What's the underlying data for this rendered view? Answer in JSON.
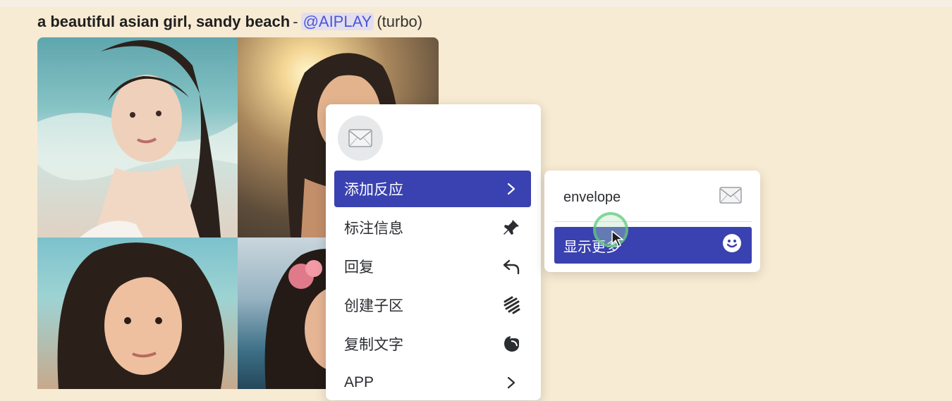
{
  "message": {
    "prompt": "a beautiful asian girl, sandy beach",
    "separator": "-",
    "mention": "@AIPLAY",
    "mode_tag": "(turbo)"
  },
  "image_grid": {
    "tiles": [
      "portrait-1",
      "portrait-2",
      "portrait-3",
      "portrait-4"
    ]
  },
  "context_menu": {
    "reaction_icon": "envelope-icon",
    "items": [
      {
        "label": "添加反应",
        "icon": "chevron-right-icon",
        "active": true
      },
      {
        "label": "标注信息",
        "icon": "pin-icon",
        "active": false
      },
      {
        "label": "回复",
        "icon": "reply-arrow-icon",
        "active": false
      },
      {
        "label": "创建子区",
        "icon": "thread-icon",
        "active": false
      },
      {
        "label": "复制文字",
        "icon": "copy-icon",
        "active": false
      },
      {
        "label": "APP",
        "icon": "chevron-right-icon",
        "active": false
      }
    ]
  },
  "reaction_submenu": {
    "items": [
      {
        "label": "envelope",
        "icon": "envelope-icon",
        "active": false
      },
      {
        "label": "显示更多",
        "icon": "smiley-icon",
        "active": true
      }
    ]
  },
  "colors": {
    "page_background": "#f8ebd3",
    "menu_active": "#3a41b0",
    "mention_text": "#4a56d6",
    "mention_background": "#e3deef"
  }
}
